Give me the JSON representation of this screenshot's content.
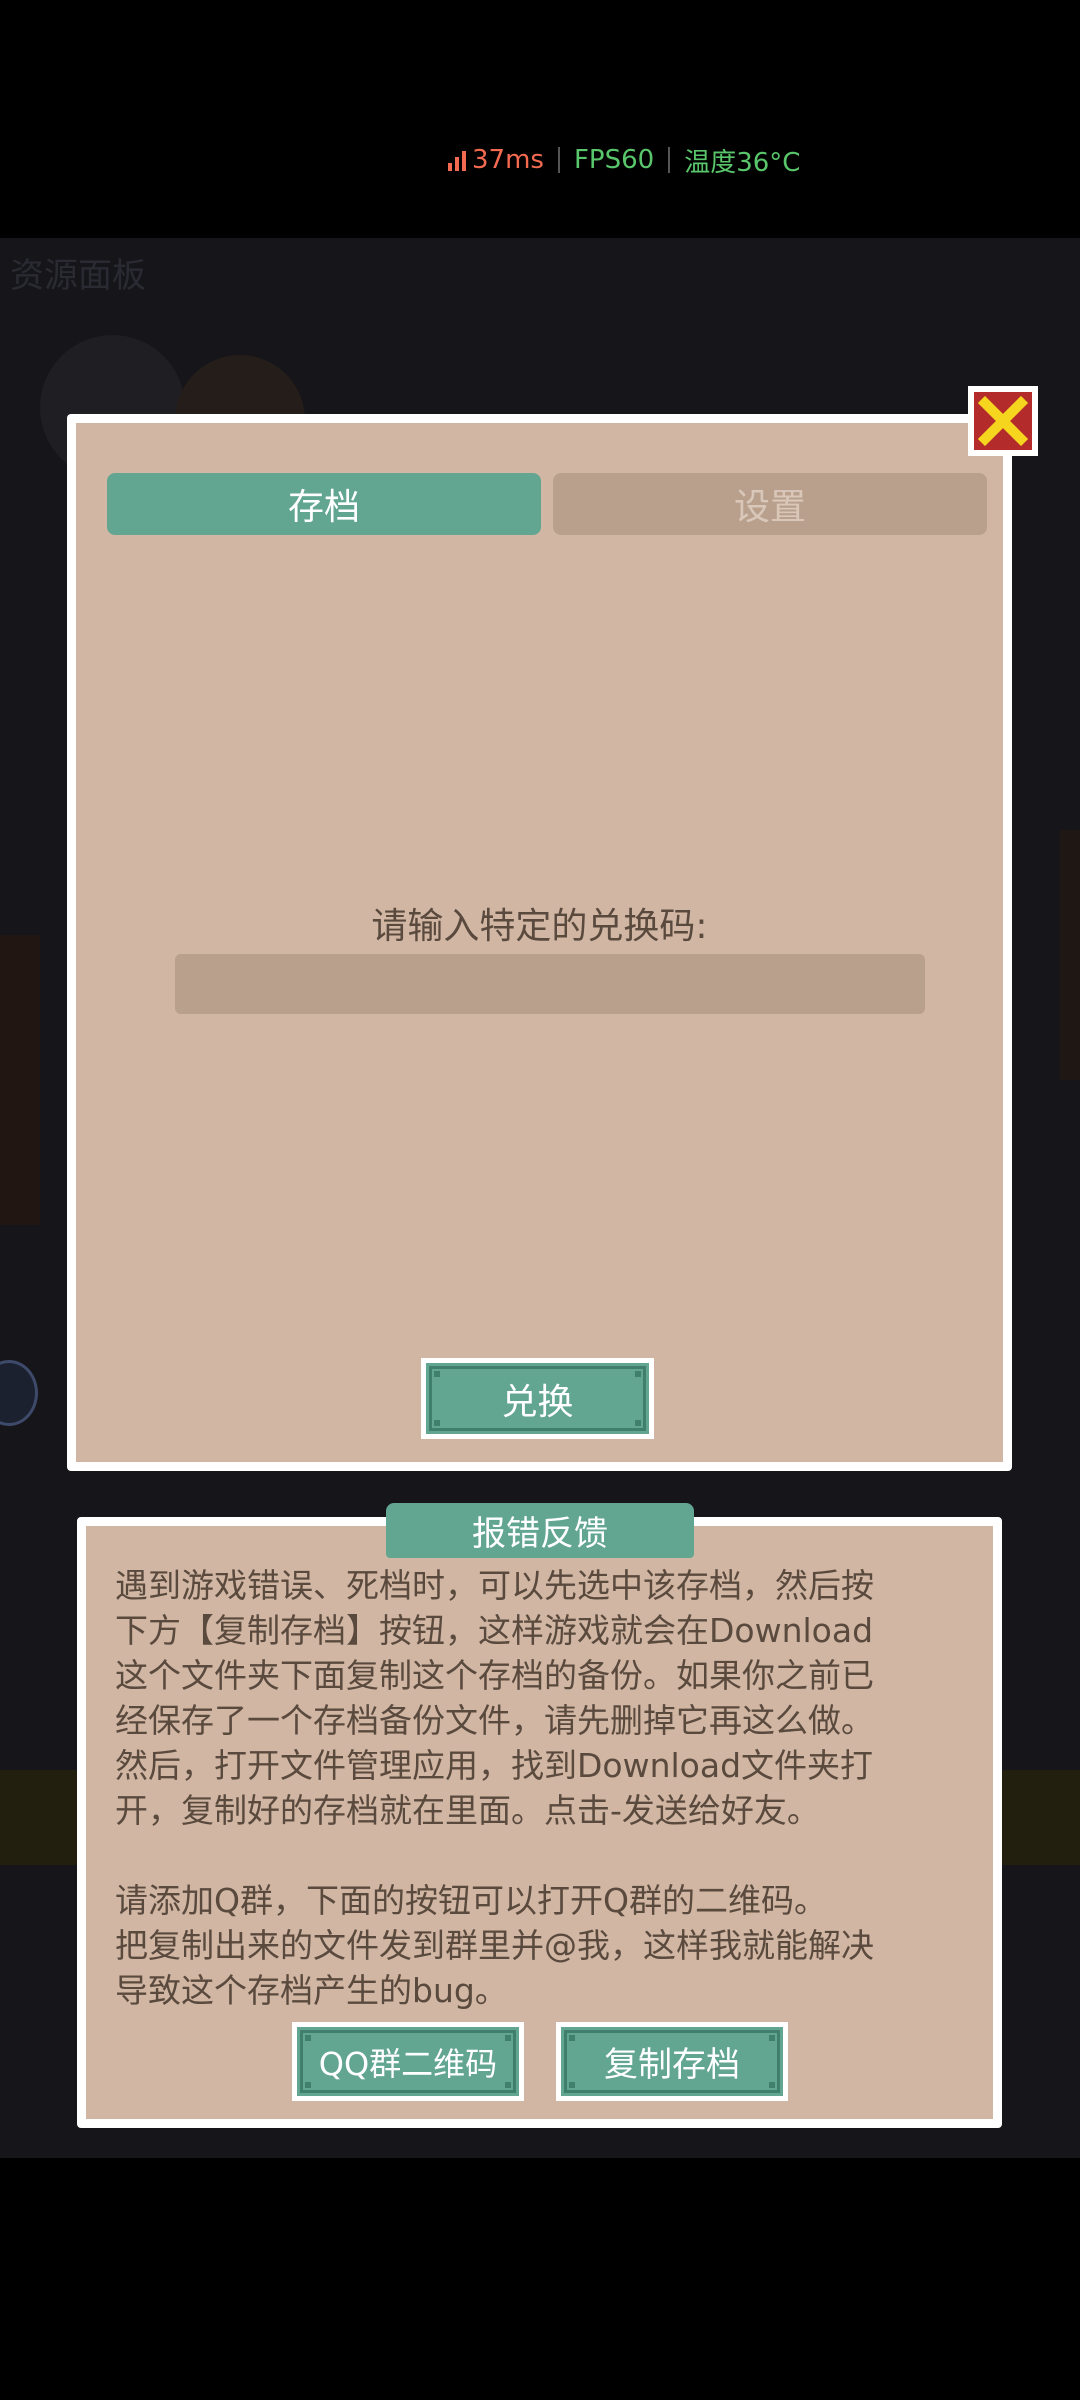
{
  "status_overlay": {
    "ping": "37ms",
    "fps": "FPS60",
    "temperature": "温度36°C"
  },
  "background": {
    "title": "资源面板"
  },
  "tabs": {
    "save": "存档",
    "settings": "设置"
  },
  "redeem": {
    "prompt": "请输入特定的兑换码:",
    "input_value": "",
    "button": "兑换"
  },
  "feedback": {
    "title": "报错反馈",
    "paragraph_1": [
      "遇到游戏错误、死档时，可以先选中该存档，然后按",
      "下方【复制存档】按钮，这样游戏就会在Download",
      "这个文件夹下面复制这个存档的备份。如果你之前已",
      "经保存了一个存档备份文件，请先删掉它再这么做。",
      "然后，打开文件管理应用，找到Download文件夹打",
      "开，复制好的存档就在里面。点击-发送给好友。"
    ],
    "paragraph_2": [
      "请添加Q群，下面的按钮可以打开Q群的二维码。",
      "把复制出来的文件发到群里并@我，这样我就能解决",
      "导致这个存档产生的bug。"
    ],
    "qr_button": "QQ群二维码",
    "copy_button": "复制存档"
  },
  "colors": {
    "panel": "#d1b6a3",
    "accent_green": "#62a691",
    "tab_inactive": "#b9a08c",
    "text": "#5a4a3e",
    "close_red": "#b32b2b",
    "close_x": "#f5d51e",
    "ping": "#f26a4f",
    "fps": "#59c66b"
  },
  "icons": {
    "signal": "signal-bars-icon",
    "close": "close-x-icon"
  }
}
